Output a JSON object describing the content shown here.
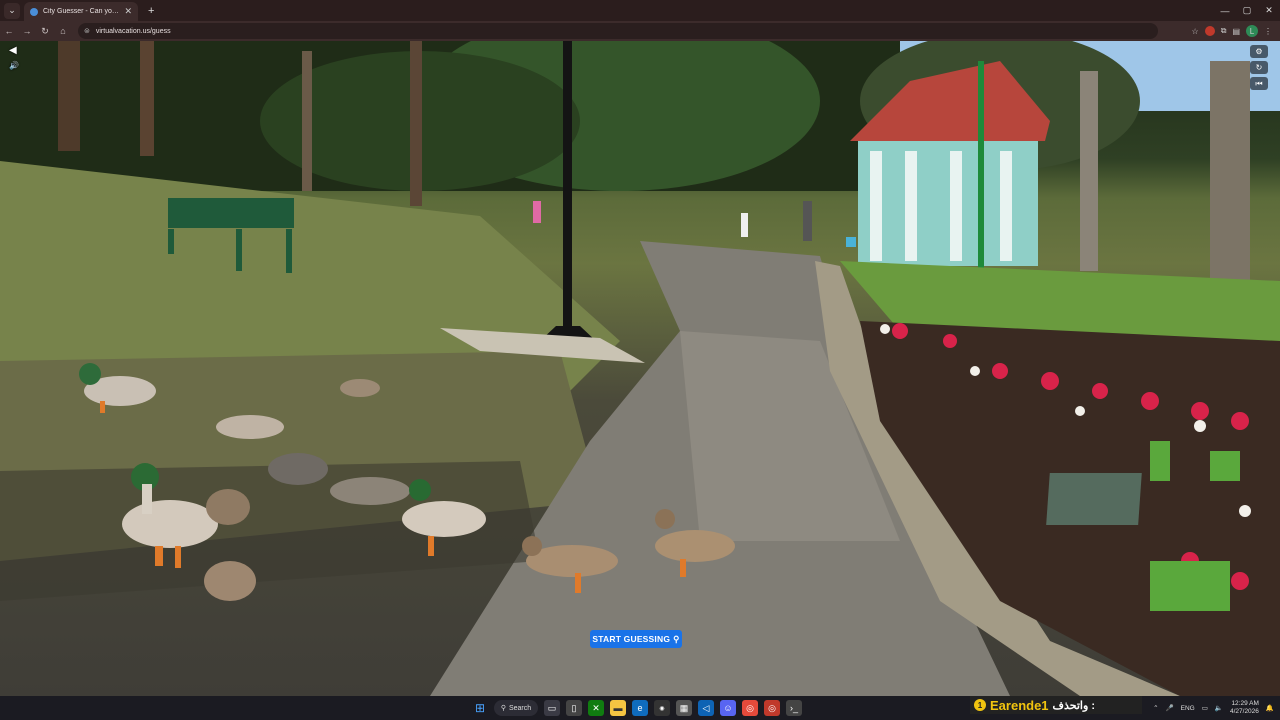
{
  "browser": {
    "tab_title": "City Guesser - Can you guess w...",
    "url": "virtualvacation.us/guess"
  },
  "game": {
    "start_button_label": "START GUESSING",
    "pin_icon": "map-pin-icon"
  },
  "taskbar": {
    "search_label": "Search",
    "streamer_badge": "1",
    "streamer_name": "Earende1",
    "streamer_text_ar": "واتحذف :",
    "language": "ENG",
    "time": "12:29 AM",
    "date": "4/27/2026"
  },
  "colors": {
    "start_button": "#1a73e8",
    "tab_bar": "#2b1d1d",
    "taskbar": "#1b1b22",
    "streamer_name": "#f1c40f"
  }
}
